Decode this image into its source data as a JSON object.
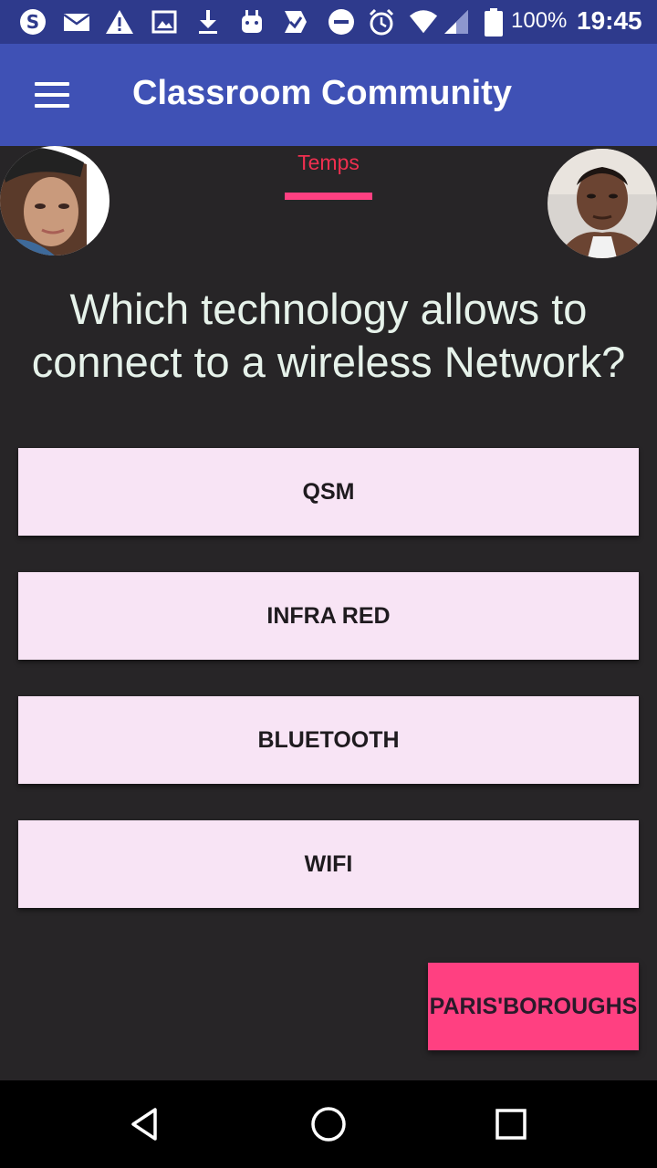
{
  "status_bar": {
    "battery_percent": "100%",
    "time": "19:45",
    "icons": [
      "skype-icon",
      "mail-icon",
      "warning-icon",
      "image-icon",
      "download-icon",
      "android-icon",
      "app-icon",
      "dnd-icon",
      "alarm-icon",
      "wifi-icon",
      "signal-icon",
      "battery-icon"
    ]
  },
  "app_bar": {
    "title": "Classroom Community",
    "menu_icon": "hamburger-menu-icon",
    "color": "#3f51b5"
  },
  "game": {
    "timer_label": "Temps",
    "question": "Which technology allows to connect to a wireless Network?",
    "answers": [
      {
        "label": "QSM"
      },
      {
        "label": "INFRA RED"
      },
      {
        "label": "BLUETOOTH"
      },
      {
        "label": "WIFI"
      }
    ],
    "team_button": "PARIS'BOROUGHS",
    "answer_color": "#f8e4f5",
    "accent_color": "#ff4081"
  },
  "nav_bar": {
    "icons": [
      "back-icon",
      "home-icon",
      "recents-icon"
    ]
  }
}
